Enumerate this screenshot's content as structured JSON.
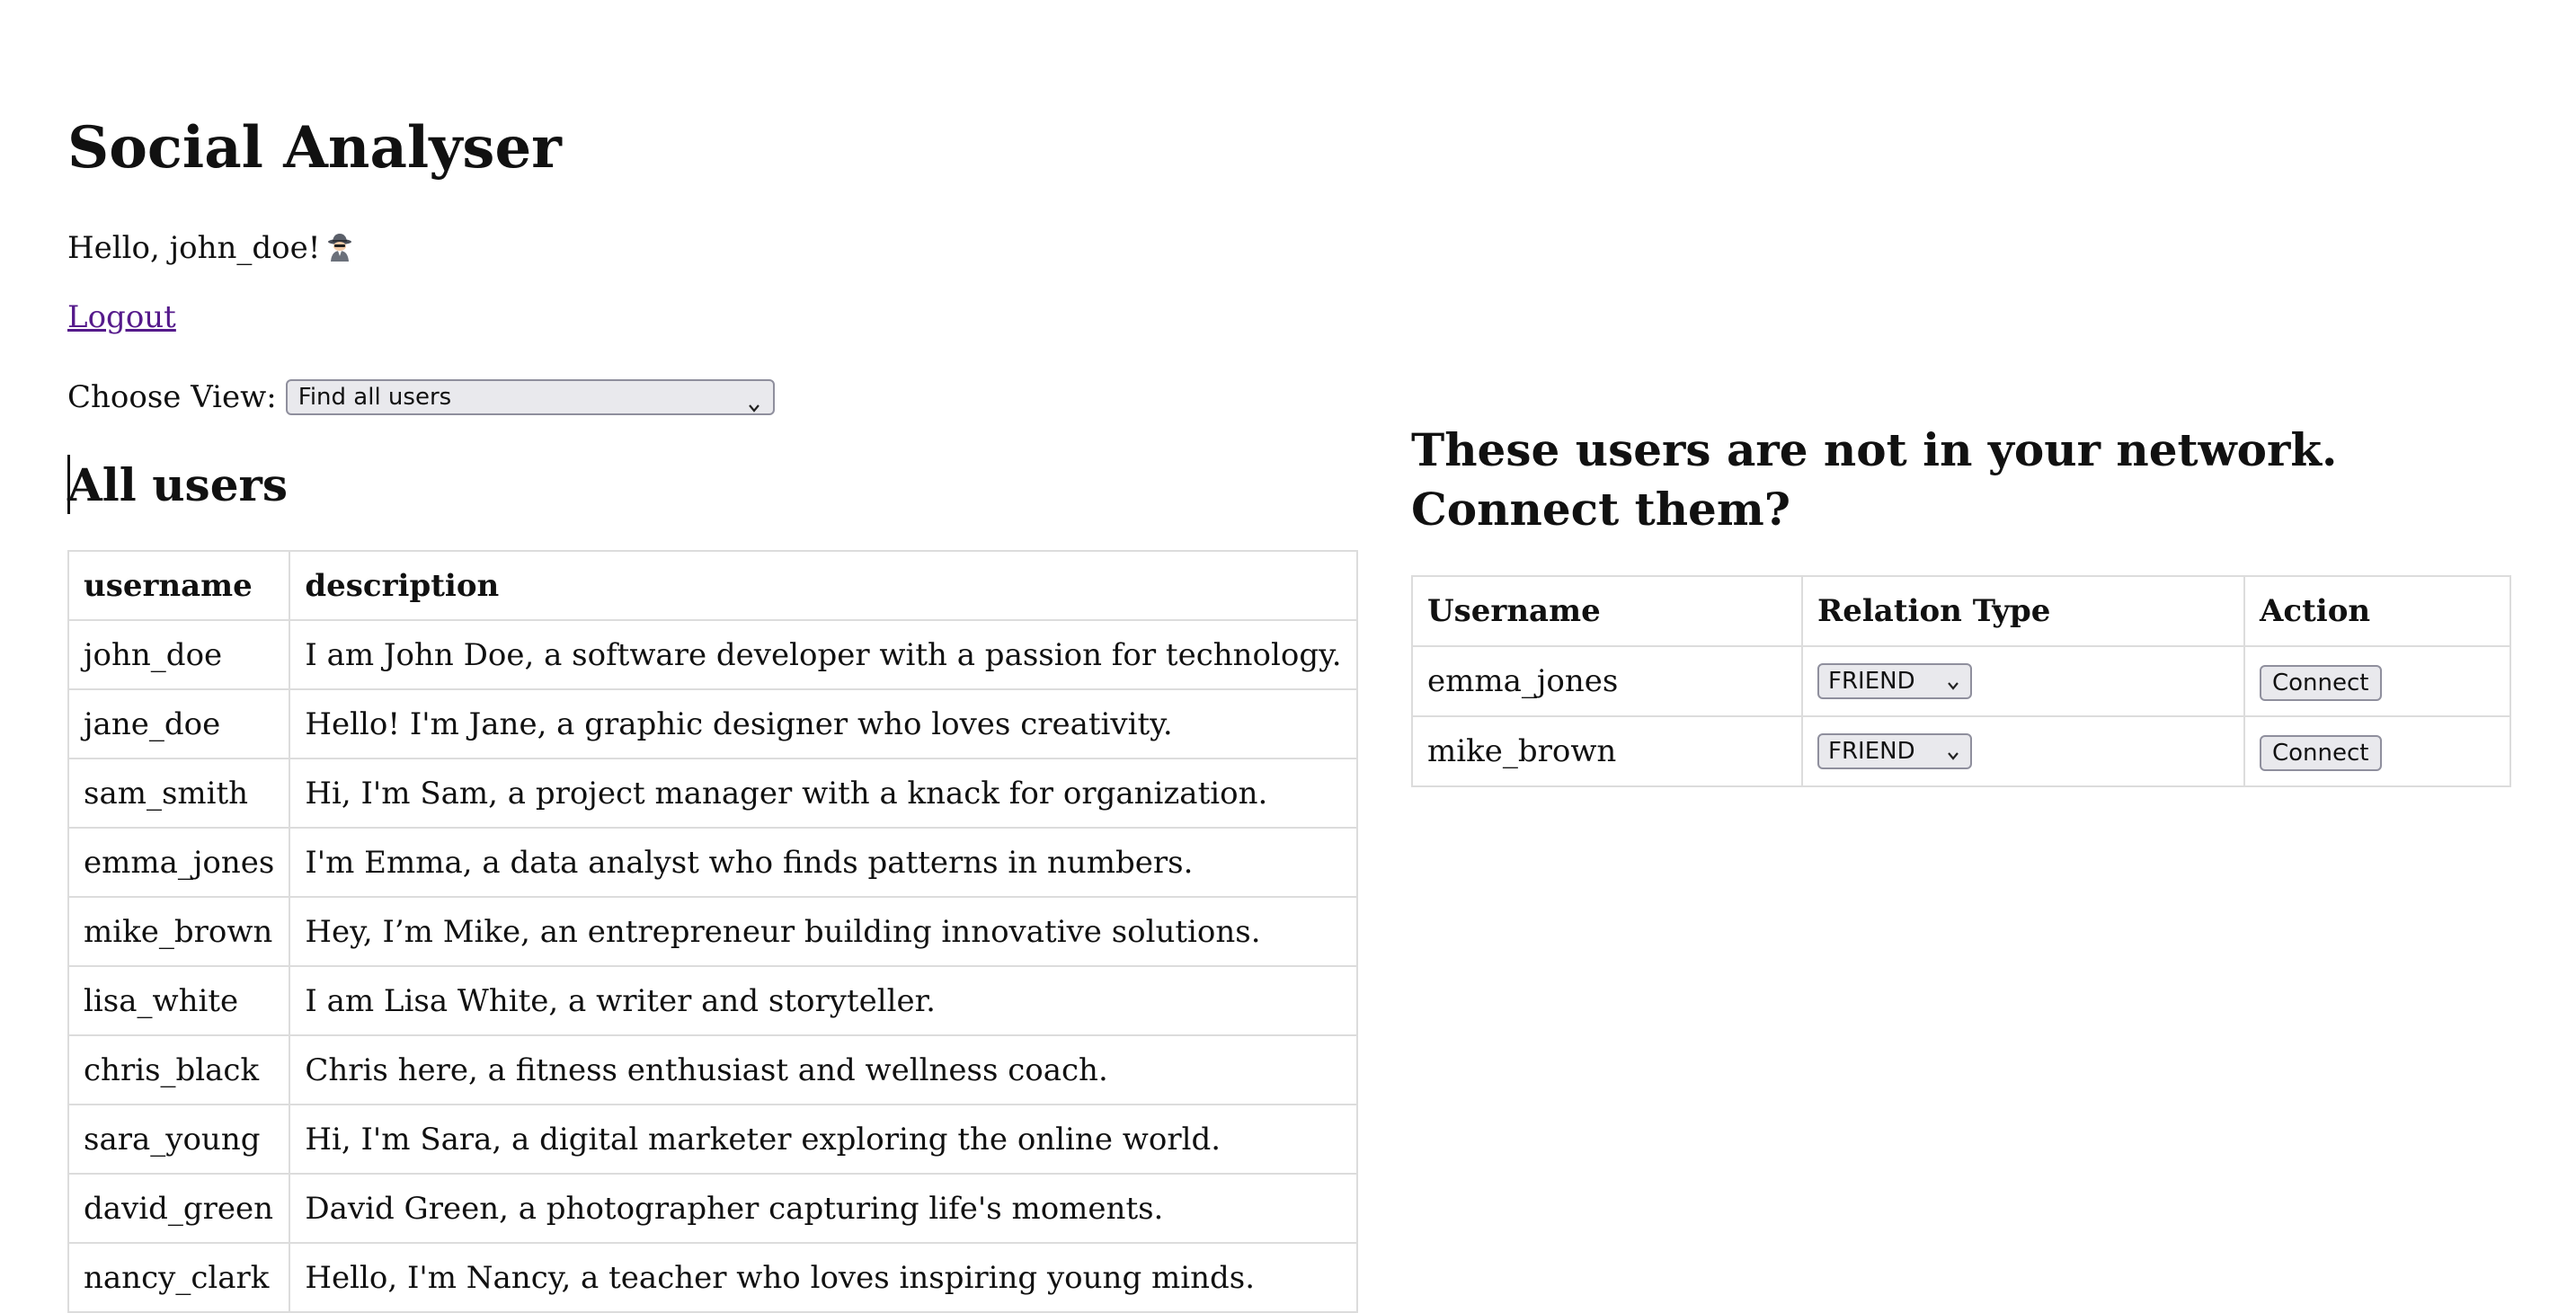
{
  "app": {
    "title": "Social Analyser"
  },
  "user": {
    "greeting": "Hello, john_doe!",
    "icon": "detective-icon"
  },
  "nav": {
    "logout_label": "Logout"
  },
  "view": {
    "label": "Choose View:",
    "selected": "Find all users"
  },
  "all_users": {
    "title": "All users",
    "headers": [
      "username",
      "description"
    ],
    "rows": [
      {
        "username": "john_doe",
        "description": "I am John Doe, a software developer with a passion for technology."
      },
      {
        "username": "jane_doe",
        "description": "Hello! I'm Jane, a graphic designer who loves creativity."
      },
      {
        "username": "sam_smith",
        "description": "Hi, I'm Sam, a project manager with a knack for organization."
      },
      {
        "username": "emma_jones",
        "description": "I'm Emma, a data analyst who finds patterns in numbers."
      },
      {
        "username": "mike_brown",
        "description": "Hey, I’m Mike, an entrepreneur building innovative solutions."
      },
      {
        "username": "lisa_white",
        "description": "I am Lisa White, a writer and storyteller."
      },
      {
        "username": "chris_black",
        "description": "Chris here, a fitness enthusiast and wellness coach."
      },
      {
        "username": "sara_young",
        "description": "Hi, I'm Sara, a digital marketer exploring the online world."
      },
      {
        "username": "david_green",
        "description": "David Green, a photographer capturing life's moments."
      },
      {
        "username": "nancy_clark",
        "description": "Hello, I'm Nancy, a teacher who loves inspiring young minds."
      }
    ]
  },
  "network": {
    "title": "These users are not in your network. Connect them?",
    "headers": [
      "Username",
      "Relation Type",
      "Action"
    ],
    "rows": [
      {
        "username": "emma_jones",
        "relation": "FRIEND",
        "action": "Connect"
      },
      {
        "username": "mike_brown",
        "relation": "FRIEND",
        "action": "Connect"
      }
    ]
  }
}
